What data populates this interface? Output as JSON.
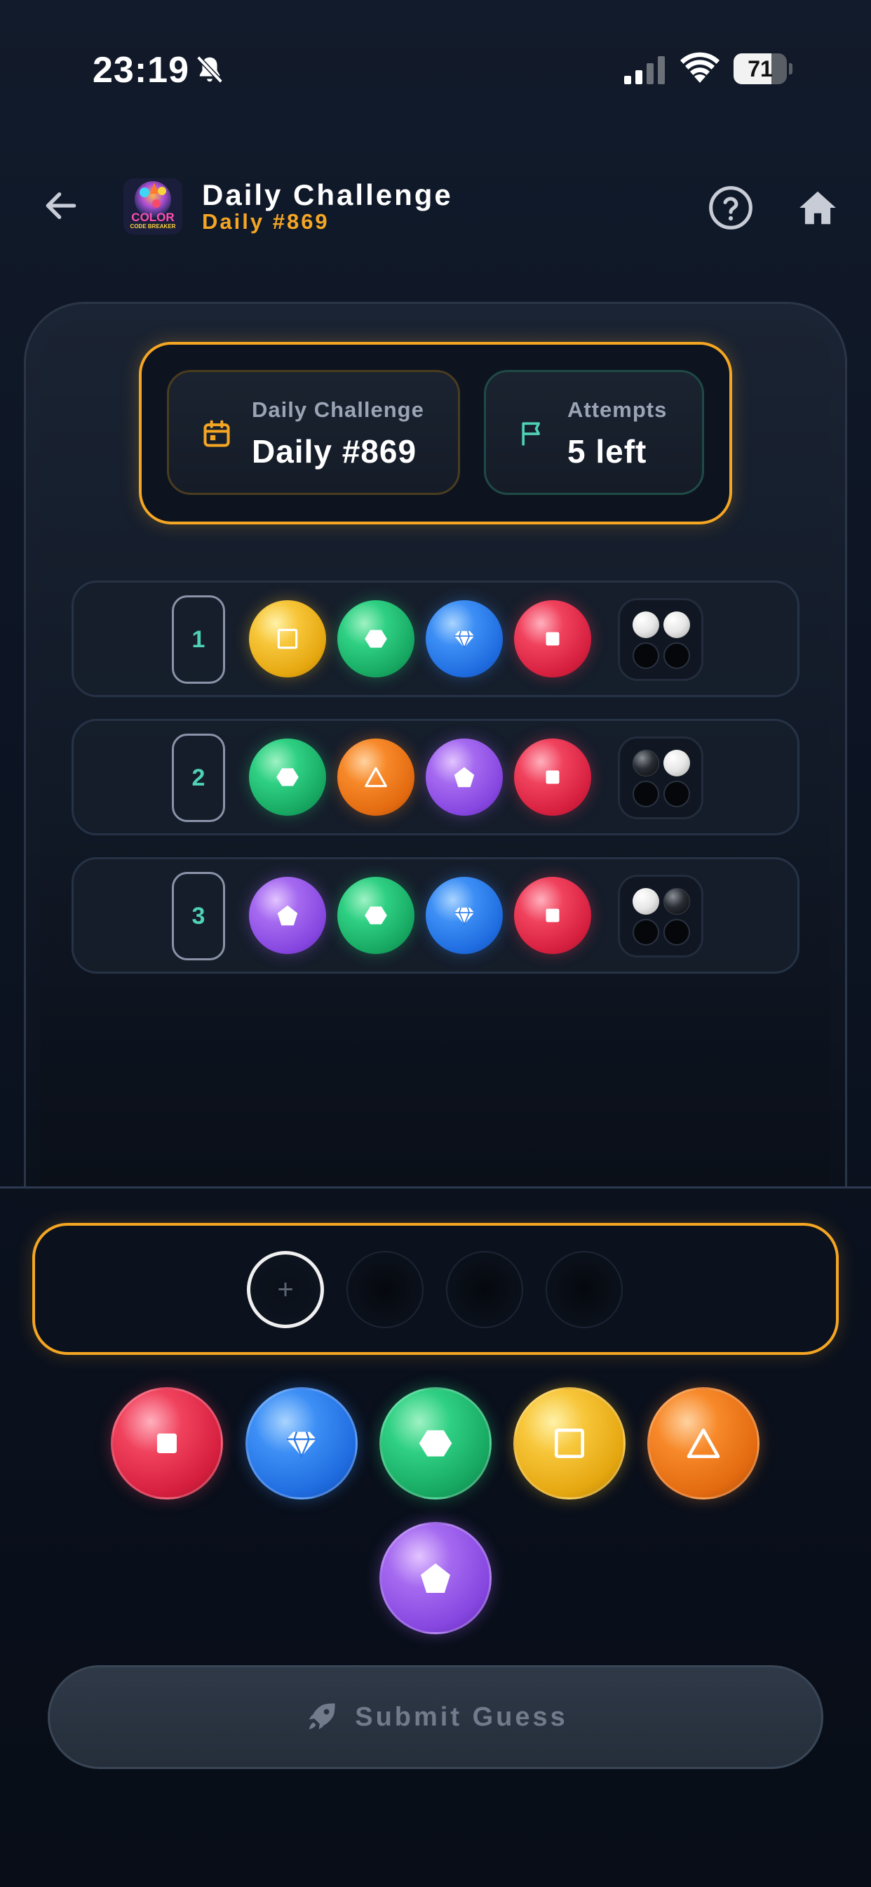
{
  "status_bar": {
    "time": "23:19",
    "battery": "71",
    "battery_level": 0.71
  },
  "header": {
    "title": "Daily Challenge",
    "subtitle": "Daily #869",
    "logo_text": "COLOR",
    "logo_subtext": "CODE BREAKER"
  },
  "info": {
    "daily_label": "Daily Challenge",
    "daily_value": "Daily #869",
    "attempts_label": "Attempts",
    "attempts_value": "5 left"
  },
  "rows": [
    {
      "number": "1",
      "pegs": [
        "yellow",
        "green",
        "blue",
        "red"
      ],
      "feedback": [
        "white",
        "white",
        "empty",
        "empty"
      ]
    },
    {
      "number": "2",
      "pegs": [
        "green",
        "orange",
        "purple",
        "red"
      ],
      "feedback": [
        "black",
        "white",
        "empty",
        "empty"
      ]
    },
    {
      "number": "3",
      "pegs": [
        "purple",
        "green",
        "blue",
        "red"
      ],
      "feedback": [
        "white",
        "black",
        "empty",
        "empty"
      ]
    }
  ],
  "current_guess": {
    "slots": [
      "empty",
      "empty",
      "empty",
      "empty"
    ],
    "active_slot_symbol": "+"
  },
  "palette": [
    "red",
    "blue",
    "green",
    "yellow",
    "orange",
    "purple"
  ],
  "submit": {
    "label": "Submit Guess"
  },
  "colors": {
    "accent": "#f5a623",
    "teal": "#4fd1b5",
    "background": "#0d1524"
  },
  "icons": {
    "red": "square-icon",
    "blue": "diamond-icon",
    "green": "hexagon-icon",
    "yellow": "square-outline-icon",
    "orange": "triangle-icon",
    "purple": "pentagon-icon"
  }
}
